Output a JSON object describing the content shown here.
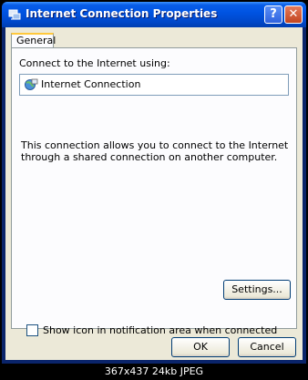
{
  "window": {
    "title": "Internet Connection Properties",
    "help_label": "?",
    "close_label": "✕"
  },
  "tabs": [
    {
      "label": "General"
    }
  ],
  "general": {
    "connect_using_label": "Connect to the Internet using:",
    "connection_name": "Internet Connection",
    "description": "This connection allows you to connect to the Internet through a shared connection on another computer.",
    "settings_button": "Settings...",
    "show_icon_checkbox_label": "Show icon in notification area when connected",
    "show_icon_checked": false
  },
  "footer": {
    "ok_button": "OK",
    "cancel_button": "Cancel"
  },
  "caption": "367x437 24kb JPEG",
  "colors": {
    "titlebar": "#0054e3",
    "face": "#ece9d8",
    "panel": "#fcfcfe",
    "close": "#c2451f"
  }
}
